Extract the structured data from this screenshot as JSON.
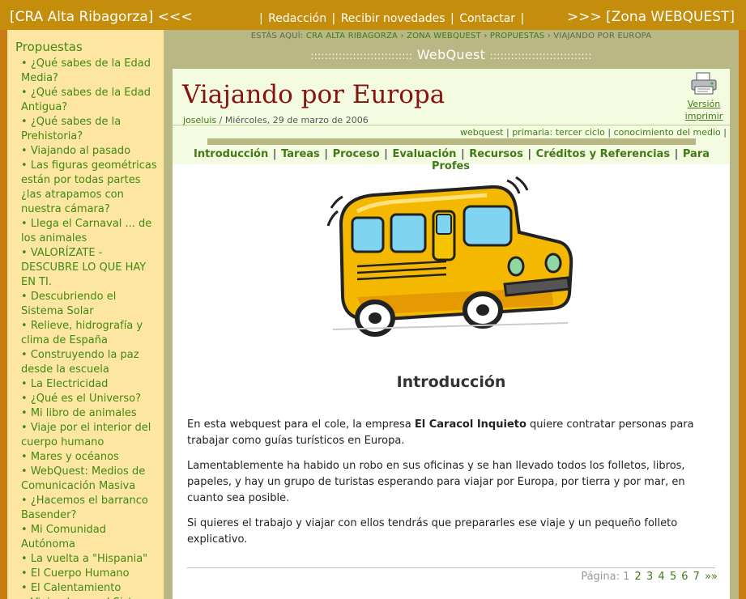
{
  "topbar": {
    "left_link": "[CRA Alta Ribagorza] <<<",
    "menu": [
      "Redacción",
      "Recibir novedades",
      "Contactar"
    ],
    "right_link": ">>> [Zona WEBQUEST]"
  },
  "sidebar": {
    "title": "Propuestas",
    "items": [
      "¿Qué sabes de la Edad Media?",
      "¿Qué sabes de la Edad Antigua?",
      "¿Qué sabes de la Prehistoria?",
      "Viajando al pasado",
      "Las figuras geométricas están por todas partes ¿las atrapamos con nuestra cámara?",
      "Llega el Carnaval ... de los animales",
      "VALORÍZATE - DESCUBRE LO QUE HAY EN TI.",
      "Descubriendo el Sistema Solar",
      "Relieve, hidrografía y clima de España",
      "Construyendo la paz desde la escuela",
      "La Electricidad",
      "¿Qué es el Universo?",
      "Mi libro de animales",
      "Viaje por el interior del cuerpo humano",
      "Mares y océanos",
      "WebQuest: Medios de Comunicación Masiva",
      "¿Hacemos el barranco Basender?",
      "Mi Comunidad Autónoma",
      "La vuelta a \"Hispania\"",
      "El Cuerpo Humano",
      "El Calentamiento",
      "Viajando por el Sistema Solar"
    ]
  },
  "breadcrumb": {
    "prefix": "ESTÁS AQUÍ:",
    "items": [
      "CRA ALTA RIBAGORZA",
      "ZONA WEBQUEST",
      "PROPUESTAS"
    ],
    "current": "VIAJANDO POR EUROPA",
    "separator": "›"
  },
  "section_bar": {
    "dots": ":::::::::::::::::::::::::::::",
    "label": "WebQuest"
  },
  "article": {
    "title": "Viajando por Europa",
    "author": "joseluis",
    "date": "Miércoles, 29 de marzo de 2006",
    "print_label_1": "Versión",
    "print_label_2": "imprimir",
    "tags": [
      "webquest",
      "primaria: tercer ciclo",
      "conocimiento del medio"
    ],
    "nav": [
      "Introducción",
      "Tareas",
      "Proceso",
      "Evaluación",
      "Recursos",
      "Créditos y Referencias",
      "Para Profes"
    ],
    "section_title": "Introducción",
    "p1_before": "En esta webquest para el cole, la empresa ",
    "p1_bold": "El Caracol Inquieto",
    "p1_after": " quiere contratar personas para trabajar como guías turísticos en Europa.",
    "p2": "Lamentablemente ha habido un robo en sus oficinas y se han llevado todos los folletos, libros, papeles, y hay un grupo de turistas esperando para viajar por Europa, por tierra y por mar, en cuanto sea posible.",
    "p3": "Si quieres el trabajo y viajar con ellos tendrás que prepararles ese viaje y un pequeño folleto explicativo."
  },
  "pager": {
    "label": "Página:",
    "current": "1",
    "pages": [
      "2",
      "3",
      "4",
      "5",
      "6",
      "7"
    ],
    "next": "»»"
  },
  "colors": {
    "topbar": "#c48d0b",
    "sidebar_bg": "#fde5a2",
    "link_green": "#3f8a12",
    "title_red": "#8b1010",
    "frame_olive": "#b9b783"
  }
}
